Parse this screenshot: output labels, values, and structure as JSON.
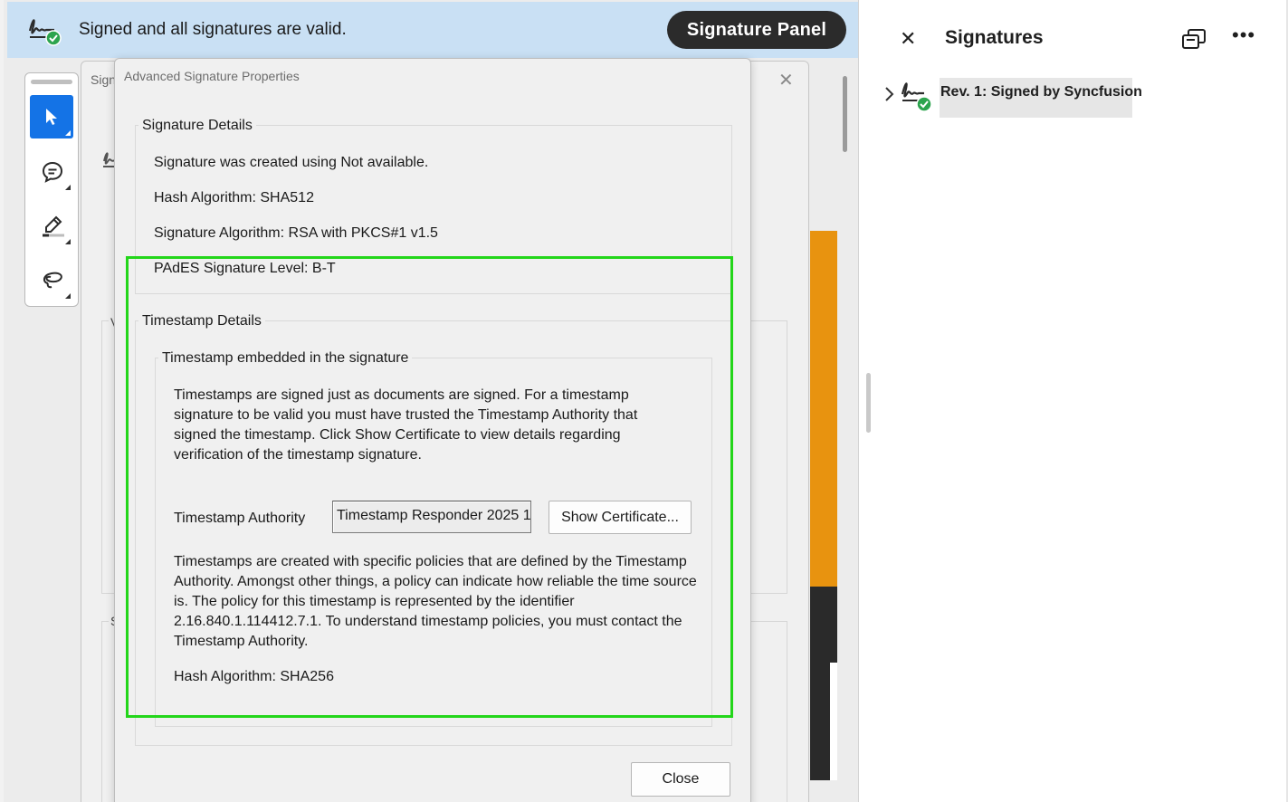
{
  "signature_bar": {
    "status_text": "Signed and all signatures are valid.",
    "panel_button_label": "Signature Panel",
    "icon": "signature-valid-icon"
  },
  "tool_rail": {
    "tools": [
      {
        "name": "select-tool",
        "icon": "cursor-arrow-icon",
        "active": true
      },
      {
        "name": "comment-tool",
        "icon": "comment-icon",
        "active": false
      },
      {
        "name": "highlight-tool",
        "icon": "pen-highlight-icon",
        "active": false
      },
      {
        "name": "draw-tool",
        "icon": "lasso-draw-icon",
        "active": false
      }
    ]
  },
  "background_dialog": {
    "title": "Sign"
  },
  "advanced_dialog": {
    "title": "Advanced Signature Properties",
    "signature_details": {
      "label": "Signature Details",
      "created_using": "Signature was created using Not available.",
      "hash_algorithm": "Hash Algorithm: SHA512",
      "signature_algorithm": "Signature Algorithm: RSA with PKCS#1 v1.5",
      "pades_level": "PAdES Signature Level: B-T"
    },
    "timestamp_details": {
      "label": "Timestamp Details",
      "embedded_label": "Timestamp embedded in the signature",
      "para_validity": "Timestamps are signed just as documents are signed. For a timestamp signature to be valid you must have trusted the Timestamp Authority that signed the timestamp. Click Show Certificate to view details regarding verification of the timestamp signature.",
      "authority_label": "Timestamp Authority",
      "authority_value": "Timestamp Responder 2025 1",
      "show_certificate_label": "Show Certificate...",
      "para_policy": "Timestamps are created with specific policies that are defined by the Timestamp Authority. Amongst other things, a policy can indicate how reliable the time source is. The policy for this timestamp is represented by the identifier 2.16.840.1.114412.7.1. To understand timestamp policies, you must contact the Timestamp Authority.",
      "hash_algorithm": "Hash Algorithm: SHA256"
    },
    "close_label": "Close"
  },
  "signatures_pane": {
    "title": "Signatures",
    "entries": [
      {
        "label": "Rev. 1: Signed by Syncfusion",
        "icon": "signature-valid-icon"
      }
    ]
  },
  "colors": {
    "accent": "#1473e6",
    "highlight_annotation": "#23d61a",
    "valid_green": "#2da44e",
    "signature_bar_bg": "#c9e0f4"
  }
}
